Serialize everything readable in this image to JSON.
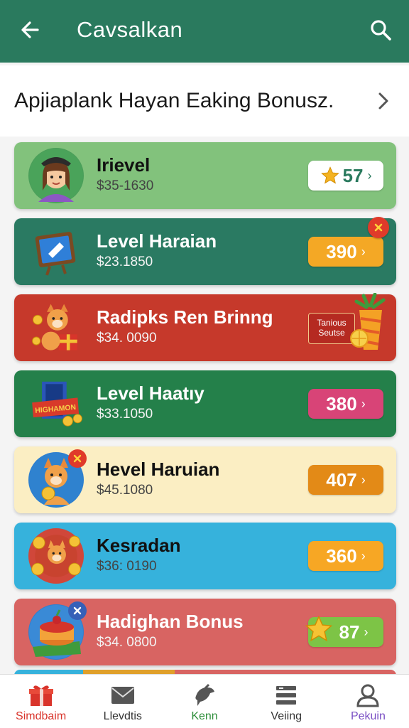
{
  "header": {
    "title": "Cavsalkan",
    "back_icon": "back-arrow-icon",
    "search_icon": "search-icon",
    "background": "#2a7a5e"
  },
  "subheader": {
    "text": "Apjiaplank Hayan Eaking Bonusz.",
    "chevron_icon": "chevron-right-icon"
  },
  "cards": [
    {
      "name": "Irievel",
      "range": "$35-1630",
      "value": "57",
      "value_prefix_icon": "star-icon",
      "thumb": "girl-avatar-icon",
      "bg": "#82c27c",
      "pill_bg": "#ffffff",
      "pill_color": "#2a7a5e"
    },
    {
      "name": "Level Haraian",
      "range": "$23.1850",
      "value": "390",
      "thumb": "ticket-board-icon",
      "bg": "#2a7a62",
      "pill_bg": "#f4a825",
      "pill_color": "#ffffff",
      "badge": "close-badge-icon"
    },
    {
      "name": "Radipks Ren Brinng",
      "range": "$34. 0090",
      "value": "",
      "thumb": "fox-gift-icon",
      "bg": "#c6392b",
      "promo_text_1": "Tanious",
      "promo_text_2": "Seutse"
    },
    {
      "name": "Level Haatıy",
      "range": "$33.1050",
      "value": "380",
      "thumb": "highamon-sign-icon",
      "thumb_text": "HIGHAMON",
      "bg": "#24804a",
      "pill_bg": "#d84477",
      "pill_color": "#ffffff"
    },
    {
      "name": "Hevel Haruian",
      "range": "$45.1080",
      "value": "407",
      "thumb": "fox-coin-icon",
      "bg": "#fbeec3",
      "pill_bg": "#e38a17",
      "pill_color": "#ffffff"
    },
    {
      "name": "Kesradan",
      "range": "$36: 0190",
      "value": "360",
      "thumb": "cat-coins-icon",
      "bg": "#36b2dc",
      "pill_bg": "#f7a724",
      "pill_color": "#ffffff"
    },
    {
      "name": "Hadighan Bonus",
      "range": "$34. 0800",
      "value": "87",
      "value_prefix_icon": "star-icon",
      "thumb": "cake-icon",
      "bg": "#d86462",
      "pill_bg": "#7dc446",
      "pill_color": "#ffffff"
    }
  ],
  "bottom_nav": [
    {
      "label": "Simdbaim",
      "icon": "gift-icon",
      "color": "#d9342b"
    },
    {
      "label": "Llevdtis",
      "icon": "mail-icon",
      "color": "#333333"
    },
    {
      "label": "Kenn",
      "icon": "bird-icon",
      "color": "#2f8f3b"
    },
    {
      "label": "Veiing",
      "icon": "list-icon",
      "color": "#333333"
    },
    {
      "label": "Pekuin",
      "icon": "user-icon",
      "color": "#7a4fc4"
    }
  ]
}
